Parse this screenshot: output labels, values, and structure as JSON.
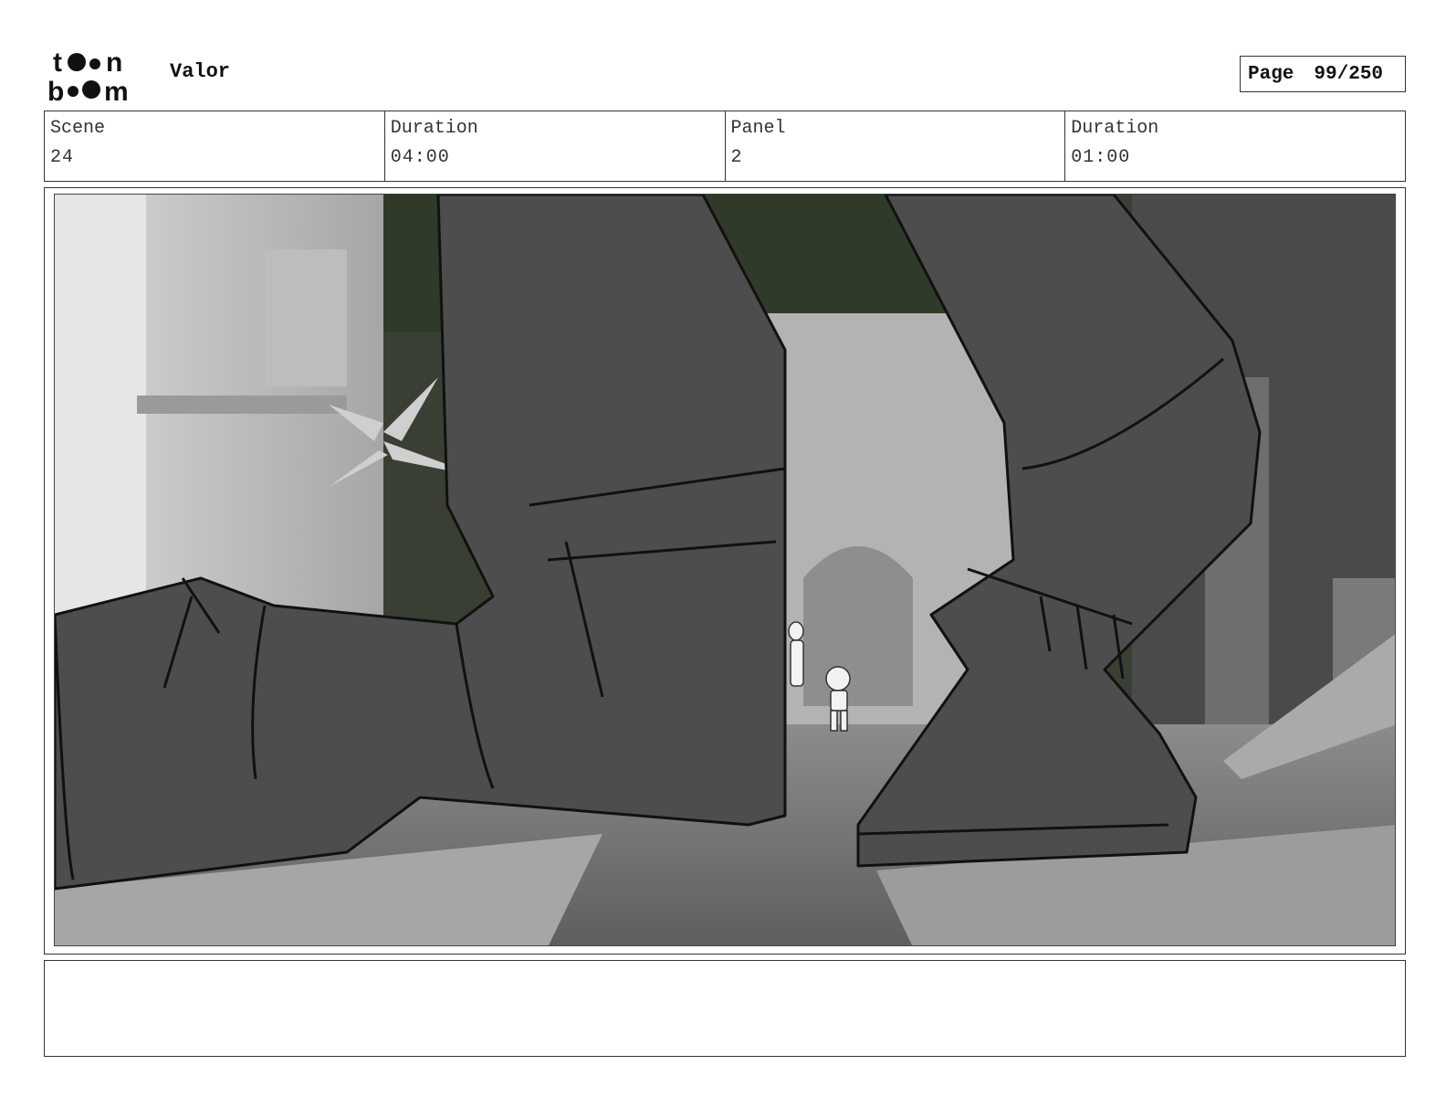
{
  "header": {
    "logo_text": "toon boom",
    "project_title": "Valor",
    "page_label": "Page",
    "page_number": "99/250"
  },
  "info": {
    "scene_label": "Scene",
    "scene_value": "24",
    "scene_duration_label": "Duration",
    "scene_duration_value": "04:00",
    "panel_label": "Panel",
    "panel_value": "2",
    "panel_duration_label": "Duration",
    "panel_duration_value": "01:00"
  },
  "panel": {
    "description_icon": "storyboard-sketch-image"
  },
  "notes": {
    "text": ""
  },
  "colors": {
    "border": "#333333",
    "sketch_fill": "#4d4d4d",
    "background_grey": "#a9a9a9"
  }
}
